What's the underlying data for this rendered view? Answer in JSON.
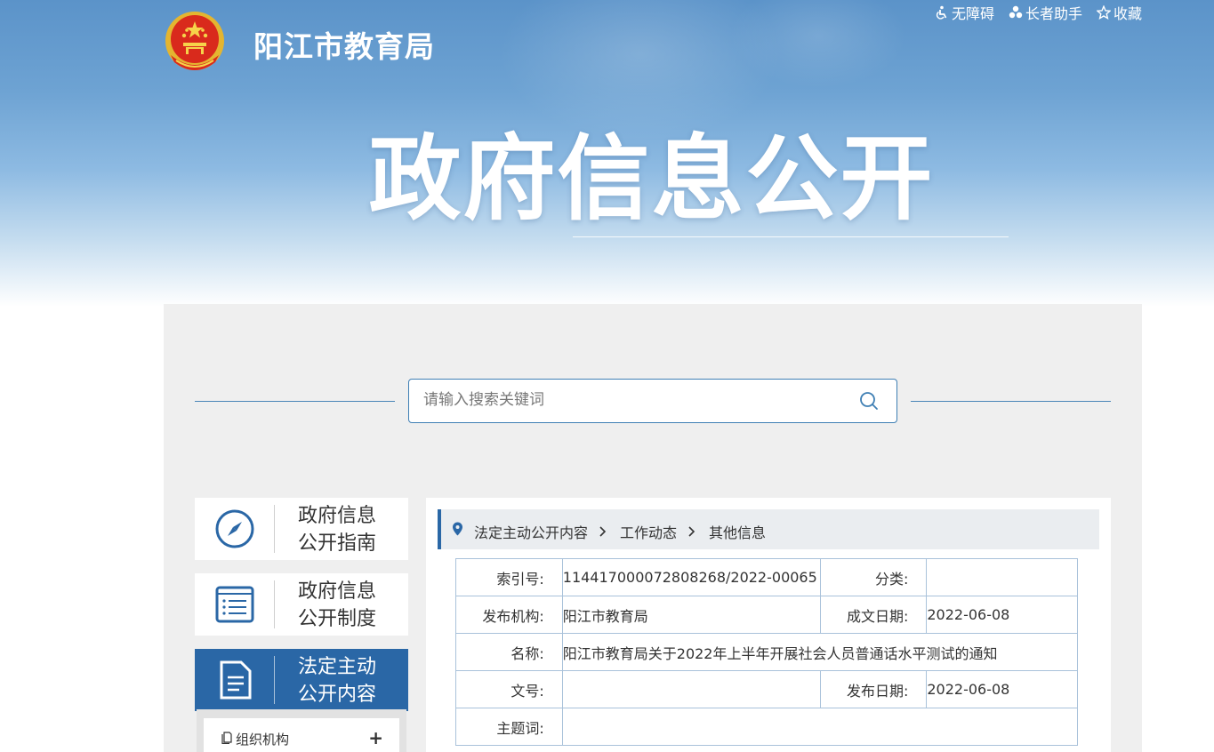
{
  "header": {
    "site_title": "阳江市教育局",
    "hero_title": "政府信息公开",
    "top_links": [
      {
        "label": "无障碍",
        "icon": "accessibility-icon"
      },
      {
        "label": "长者助手",
        "icon": "elder-assist-icon"
      },
      {
        "label": "收藏",
        "icon": "star-icon"
      }
    ]
  },
  "search": {
    "placeholder": "请输入搜索关键词",
    "value": ""
  },
  "sidebar": {
    "items": [
      {
        "line1": "政府信息",
        "line2": "公开指南",
        "icon": "compass-icon",
        "active": false
      },
      {
        "line1": "政府信息",
        "line2": "公开制度",
        "icon": "list-book-icon",
        "active": false
      },
      {
        "line1": "法定主动",
        "line2": "公开内容",
        "icon": "document-icon",
        "active": true
      }
    ],
    "sub_items": [
      {
        "label": "组织机构",
        "expand": "+"
      }
    ]
  },
  "breadcrumb": [
    "法定主动公开内容",
    "工作动态",
    "其他信息"
  ],
  "meta": {
    "index_label": "索引号:",
    "index_value": "114417000072808268/2022-00065",
    "category_label": "分类:",
    "category_value": "",
    "publisher_label": "发布机构:",
    "publisher_value": "阳江市教育局",
    "created_label": "成文日期:",
    "created_value": "2022-06-08",
    "name_label": "名称:",
    "name_value": "阳江市教育局关于2022年上半年开展社会人员普通话水平测试的通知",
    "docno_label": "文号:",
    "docno_value": "",
    "published_label": "发布日期:",
    "published_value": "2022-06-08",
    "keywords_label": "主题词:",
    "keywords_value": ""
  },
  "colors": {
    "brand_blue": "#2a67a6",
    "line_blue": "#4a86b8",
    "table_border": "#a9c2da",
    "panel_bg": "#efefef"
  }
}
